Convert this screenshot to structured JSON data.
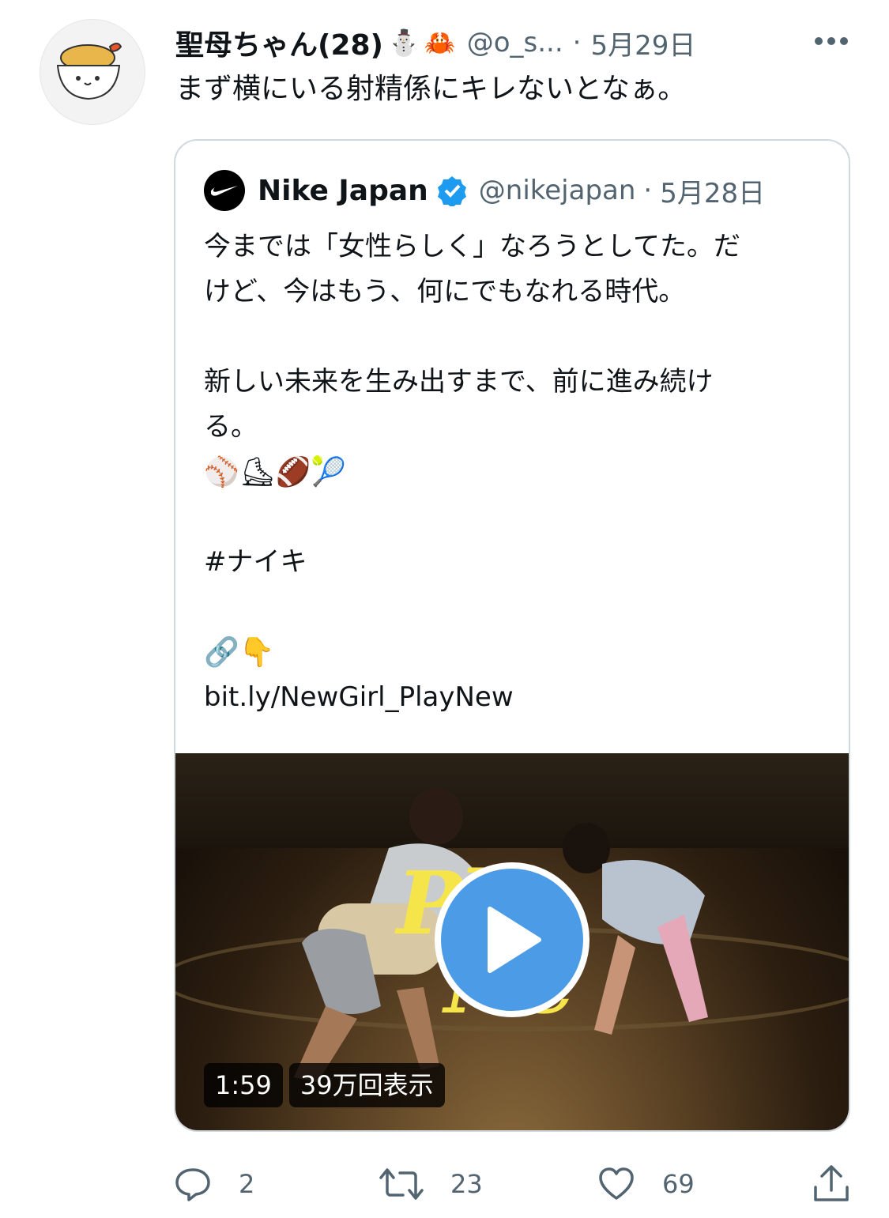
{
  "tweet": {
    "display_name": "聖母ちゃん(28)",
    "name_emoji_1": "⛄",
    "name_emoji_2": "🦀",
    "handle": "@o_s...",
    "separator": "·",
    "date": "5月29日",
    "text": "まず横にいる射精係にキレないとなぁ。",
    "more_icon": "more-horizontal-icon",
    "avatar_icon": "tempura-bowl-avatar"
  },
  "quote": {
    "display_name": "Nike Japan",
    "handle": "@nikejapan",
    "separator": "·",
    "date": "5月28日",
    "verified_icon": "verified-badge-icon",
    "lines": {
      "l1": "今までは「女性らしく」なろうとしてた。だ",
      "l2": "けど、今はもう、何にでもなれる時代。",
      "l3": "新しい未来を生み出すまで、前に進み続け",
      "l4": "る。",
      "emojis": "⚾⛸🏈🎾",
      "hashtag": "#ナイキ",
      "link_emojis": "🔗👇",
      "link": "bit.ly/NewGirl_PlayNew"
    },
    "video": {
      "overlay_text_1": "Pl",
      "overlay_text_2": "Ne",
      "duration": "1:59",
      "views": "39万回表示",
      "play_icon": "play-icon"
    }
  },
  "actions": {
    "reply_count": "2",
    "retweet_count": "23",
    "like_count": "69",
    "colors": {
      "icon": "#536471"
    }
  },
  "colors": {
    "text": "#0f1419",
    "secondary": "#536471",
    "border": "#cfd9de",
    "verified": "#1d9bf0",
    "play_button": "#4b9be6",
    "overlay_yellow": "#f5e54a"
  }
}
